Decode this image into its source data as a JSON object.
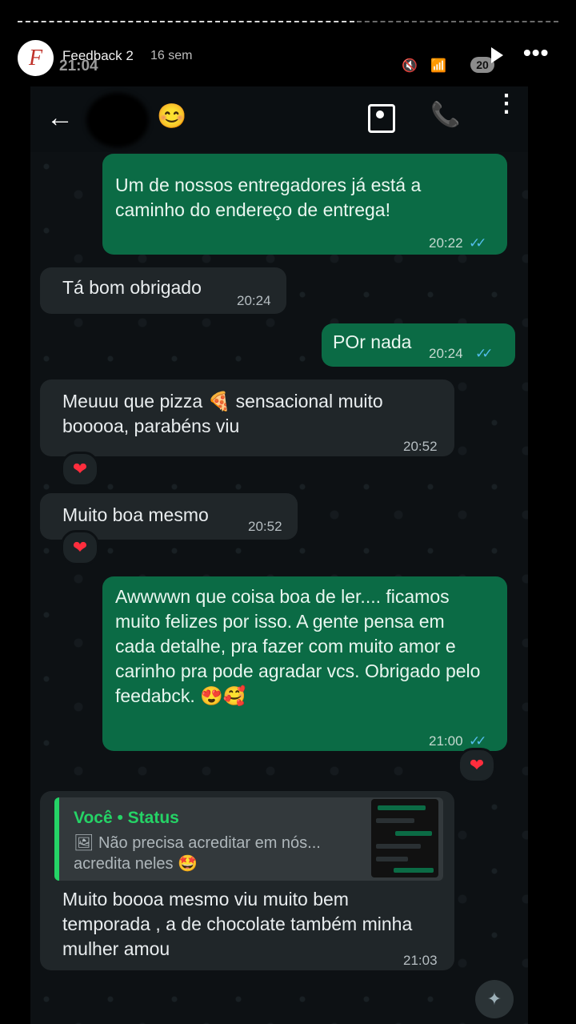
{
  "story": {
    "title": "Feedback 2",
    "age": "16 sem",
    "avatar_letter": "F",
    "more": "•••"
  },
  "status_bar": {
    "time": "21:04",
    "icons": "🔇 📶",
    "battery": "20"
  },
  "chat_header": {
    "back": "←",
    "contact_emoji": "😊",
    "call_icon": "📞",
    "menu": "⋮"
  },
  "messages": [
    {
      "from": "me",
      "text": "Um de nossos entregadores já está a caminho do endereço de entrega!",
      "time": "20:22",
      "ticks": "✓✓"
    },
    {
      "from": "them",
      "text": "Tá bom obrigado",
      "time": "20:24"
    },
    {
      "from": "me",
      "text": "POr nada",
      "time": "20:24",
      "ticks": "✓✓"
    },
    {
      "from": "them",
      "text": "Meuuu que pizza 🍕 sensacional muito booooa, parabéns viu",
      "time": "20:52",
      "reaction": "❤"
    },
    {
      "from": "them",
      "text": "Muito boa mesmo",
      "time": "20:52",
      "reaction": "❤"
    },
    {
      "from": "me",
      "text": "Awwwwn que coisa boa de ler.... ficamos muito felizes por isso. A gente pensa em cada detalhe, pra fazer com muito amor e carinho pra pode agradar vcs. Obrigado pelo feedabck. 😍🥰",
      "time": "21:00",
      "ticks": "✓✓",
      "reaction": "❤"
    },
    {
      "from": "them",
      "quote": {
        "author": "Você • Status",
        "line1": "🖼 Não precisa acreditar em nós...",
        "line2": "acredita neles 🤩"
      },
      "text": "Muito boooa mesmo viu muito bem temporada , a de chocolate também minha mulher amou",
      "time": "21:03"
    }
  ],
  "fab_icon": "✦",
  "colors": {
    "outgoing": "#0b6b45",
    "incoming": "#202629",
    "accent": "#25d366",
    "ticks": "#53bdeb",
    "heart": "#ff2d3d"
  }
}
